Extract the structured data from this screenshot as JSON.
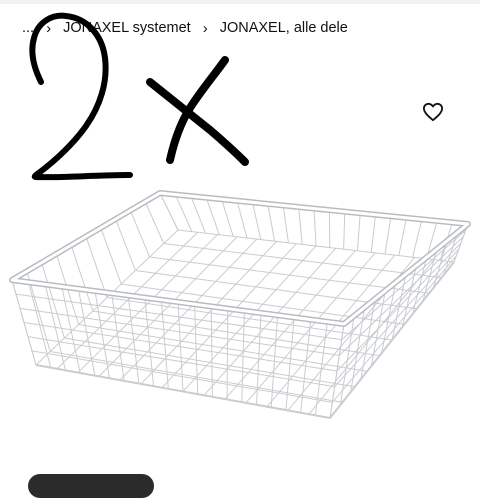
{
  "breadcrumb": {
    "items": [
      {
        "label": "..."
      },
      {
        "label": "JONAXEL systemet"
      },
      {
        "label": "JONAXEL, alle dele"
      }
    ],
    "separator": "›"
  },
  "annotation": {
    "text": "2x",
    "ink_color": "#000000"
  },
  "icons": {
    "wishlist": "heart-outline-icon"
  },
  "product": {
    "image": "white wire mesh basket",
    "color": "#ffffff"
  }
}
